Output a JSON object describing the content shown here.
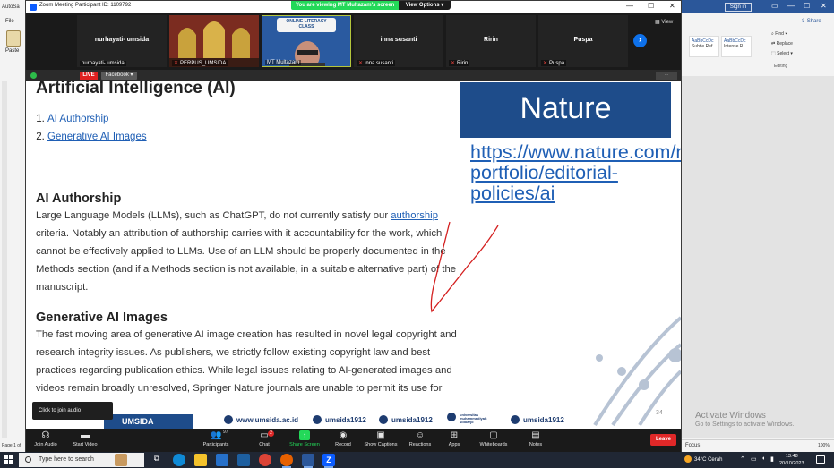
{
  "word": {
    "autosave": "AutoSa",
    "file_tab": "File",
    "paste_label": "Paste",
    "page_status": "Page 1 of",
    "sign_in": "Sign in",
    "share": "Share",
    "styles": [
      {
        "preview": "AaBbCcDc",
        "name": "Subtle Ref..."
      },
      {
        "preview": "AaBbCcDc",
        "name": "Intense R..."
      }
    ],
    "editing": {
      "find": "Find",
      "replace": "Replace",
      "select": "Select",
      "label": "Editing"
    },
    "focus": "Focus",
    "zoom": "100%",
    "activate_title": "Activate Windows",
    "activate_sub": "Go to Settings to activate Windows."
  },
  "zoom": {
    "window_title": "Zoom Meeting Participant ID: 1109792",
    "viewing_banner": "You are viewing MT Multazam's screen",
    "view_options": "View Options",
    "view_label": "View",
    "participants": [
      {
        "name": "nurhayati- umsida",
        "label": "nurhayati- umsida",
        "muted": false
      },
      {
        "name": "",
        "label": "PERPUS_UMSIDA",
        "muted": true
      },
      {
        "name": "",
        "label": "MT Multazam",
        "muted": false
      },
      {
        "name": "inna susanti",
        "label": "inna susanti",
        "muted": true
      },
      {
        "name": "Ririn",
        "label": "Ririn",
        "muted": true
      },
      {
        "name": "Puspa",
        "label": "Puspa",
        "muted": true
      }
    ],
    "literacy_class": "ONLINE LITERACY CLASS",
    "live": "LIVE",
    "facebook": "Facebook",
    "join_audio_tip": "Click to join audio",
    "toolbar": {
      "join_audio": "Join Audio",
      "start_video": "Start Video",
      "participants": "Participants",
      "participants_count": "97",
      "chat": "Chat",
      "chat_count": "2",
      "share_screen": "Share Screen",
      "record": "Record",
      "show_captions": "Show Captions",
      "reactions": "Reactions",
      "apps": "Apps",
      "whiteboards": "Whiteboards",
      "notes": "Notes",
      "leave": "Leave"
    }
  },
  "slide": {
    "title": "Artificial Intelligence (AI)",
    "toc": [
      "AI Authorship",
      "Generative AI Images"
    ],
    "sec1_title": "AI Authorship",
    "sec1_p1_a": "Large Language Models (LLMs), such as ChatGPT, do not currently satisfy our ",
    "sec1_p1_link": "authorship",
    "sec1_p1_b": " criteria. Notably an attribution of authorship carries with it accountability for the work, which cannot be effectively applied to LLMs.   Use of an LLM should be properly documented in the Methods section (and if a Methods section is not available, in a suitable alternative part) of the manuscript.",
    "sec2_title": "Generative AI Images",
    "sec2_p1": "The fast moving area of generative AI image creation has resulted in novel legal copyright and research integrity issues. As publishers, we strictly follow existing copyright law and best practices regarding publication ethics. While legal issues relating to AI-generated images and videos remain broadly unresolved, Springer Nature journals are unable to permit its use for",
    "nature_box": "Nature",
    "nature_link": "https://www.nature.com/nature-portfolio/editorial-policies/ai",
    "slide_number": "34",
    "footer_logo": "UMSIDA",
    "footer_web": "www.umsida.ac.id",
    "footer_ig": "umsida1912",
    "footer_tw": "umsida1912",
    "footer_fb_line1": "universitas",
    "footer_fb_line2": "muhammadiyah",
    "footer_fb_line3": "sidoarjo",
    "footer_yt": "umsida1912"
  },
  "taskbar": {
    "search_placeholder": "Type here to search",
    "weather": "34°C  Cerah",
    "time": "13:48",
    "date": "20/10/2023"
  },
  "colors": {
    "zoom_green": "#23d959",
    "zoom_blue": "#0e71eb",
    "nature_blue": "#1e4c8a",
    "link_blue": "#1f5fb5",
    "leave_red": "#e02828",
    "annotation_red": "#d42020"
  }
}
